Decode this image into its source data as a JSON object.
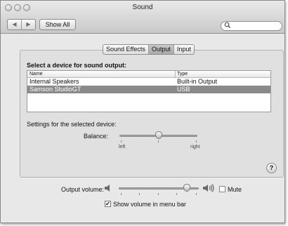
{
  "window": {
    "title": "Sound"
  },
  "toolbar": {
    "back_glyph": "◀",
    "forward_glyph": "▶",
    "show_all_label": "Show All",
    "search": {
      "placeholder": "",
      "value": ""
    }
  },
  "tabs": [
    {
      "label": "Sound Effects",
      "active": false
    },
    {
      "label": "Output",
      "active": true
    },
    {
      "label": "Input",
      "active": false
    }
  ],
  "output": {
    "heading": "Select a device for sound output:",
    "columns": [
      "Name",
      "Type"
    ],
    "devices": [
      {
        "name": "Internal Speakers",
        "type": "Built-in Output",
        "selected": false
      },
      {
        "name": "Samson StudioGT",
        "type": "USB",
        "selected": true
      }
    ],
    "settings_label": "Settings for the selected device:",
    "balance": {
      "label": "Balance:",
      "left_label": "left",
      "right_label": "right",
      "value": 0.5
    }
  },
  "help": {
    "label": "?"
  },
  "volume": {
    "label": "Output volume:",
    "level": 0.85,
    "mute_label": "Mute",
    "mute_checked": false,
    "show_in_menubar_label": "Show volume in menu bar",
    "show_in_menubar_checked": true,
    "check_glyph": "✔"
  },
  "colors": {
    "selection": "#8a8a8a"
  }
}
